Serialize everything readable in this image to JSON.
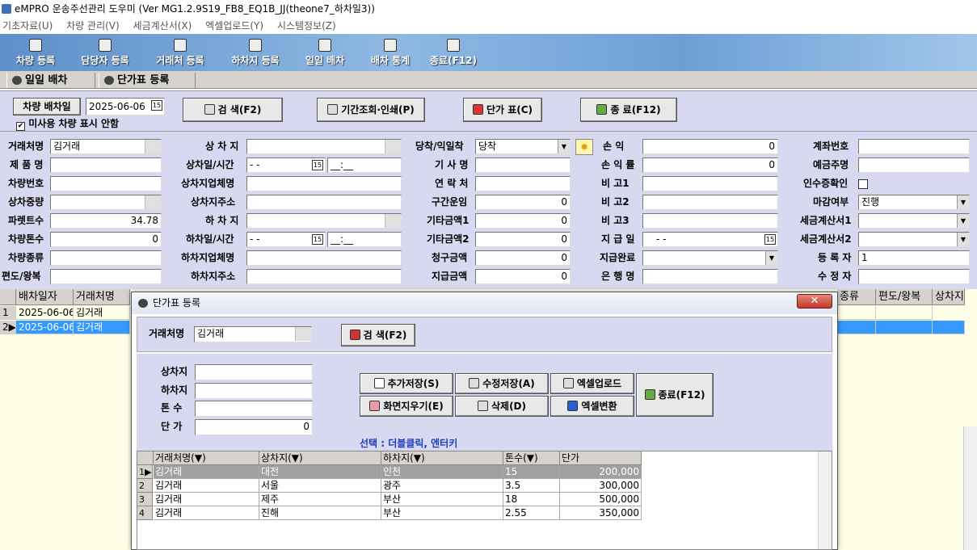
{
  "window": {
    "title": "eMPRO 운송주선관리 도우미 (Ver MG1.2.9S19_FB8_EQ1B_JJ(theone7_하차일3))"
  },
  "menu": [
    "기초자료(U)",
    "차량 관리(V)",
    "세금계산서(X)",
    "엑셀업로드(Y)",
    "시스템정보(Z)"
  ],
  "toolbar": [
    "차량 등록",
    "담당자 등록",
    "거래처 등록",
    "하차지 등록",
    "일일 배차",
    "배차 통계",
    "종료(F12)"
  ],
  "tabs": [
    "일일 배차",
    "단가표 등록"
  ],
  "top": {
    "date_label": "차량 배차일",
    "date_value": "2025-06-06",
    "search": "검 색(F2)",
    "period": "기간조회·인쇄(P)",
    "price": "단가 표(C)",
    "close": "종 료(F12)",
    "unused_label": "미사용 차량 표시 안함"
  },
  "form": {
    "client_label": "거래처명",
    "client_value": "김거래",
    "product_label": "제 품 명",
    "vehicle_no_label": "차량번호",
    "load_weight_label": "상차중량",
    "pallet_label": "파렛트수",
    "pallet_value": "34.78",
    "tonnage_label": "차량톤수",
    "tonnage_value": "0",
    "vehicle_type_label": "차량종류",
    "oneway_label": "편도/왕복",
    "load_place_label": "상 차 지",
    "load_time_label": "상차일/시간",
    "load_date_value": "- -",
    "load_time_value": "__:__",
    "load_company_label": "상차지업체명",
    "load_addr_label": "상차지주소",
    "unload_place_label": "하 차 지",
    "unload_time_label": "하차일/시간",
    "unload_date_value": "- -",
    "unload_time_value": "__:__",
    "unload_company_label": "하차지업체명",
    "unload_addr_label": "하차지주소",
    "arrival_label": "당착/익일착",
    "arrival_value": "당착",
    "driver_label": "기 사 명",
    "contact_label": "연 락 처",
    "section_fare_label": "구간운임",
    "section_fare_value": "0",
    "other1_label": "기타금액1",
    "other1_value": "0",
    "other2_label": "기타금액2",
    "other2_value": "0",
    "bill_label": "청구금액",
    "bill_value": "0",
    "pay_label": "지급금액",
    "pay_value": "0",
    "profit_label": "손 익",
    "profit_value": "0",
    "profit_rate_label": "손 익 률",
    "profit_rate_value": "0",
    "note1_label": "비 고1",
    "note2_label": "비 고2",
    "note3_label": "비 고3",
    "pay_date_label": "지 급 일",
    "pay_date_value": "- -",
    "pay_done_label": "지급완료",
    "bank_label": "은 행 명",
    "account_label": "계좌번호",
    "holder_label": "예금주명",
    "receipt_label": "인수증확인",
    "close_label": "마감여부",
    "close_value": "진행",
    "tax1_label": "세금계산서1",
    "tax2_label": "세금계산서2",
    "registrar_label": "등 록 자",
    "registrar_value": "1",
    "modifier_label": "수 정 자"
  },
  "grid": {
    "headers": [
      "배차일자",
      "거래처명",
      "종류",
      "편도/왕복",
      "상차지"
    ],
    "rows": [
      {
        "no": "1",
        "date": "2025-06-06",
        "client": "김거래"
      },
      {
        "no": "2",
        "date": "2025-06-06",
        "client": "김거래"
      }
    ]
  },
  "dialog": {
    "title": "단가표 등록",
    "close": "✕",
    "client_label": "거래처명",
    "client_value": "김거래",
    "search": "검 색(F2)",
    "load_label": "상차지",
    "unload_label": "하차지",
    "ton_label": "톤 수",
    "price_label": "단 가",
    "price_value": "0",
    "add": "추가저장(S)",
    "edit": "수정저장(A)",
    "excel_upload": "엑셀업로드",
    "clear": "화면지우기(E)",
    "delete": "삭제(D)",
    "excel_convert": "엑셀변환",
    "close_btn": "종료(F12)",
    "hint": "선택 : 더블클릭, 엔터키",
    "headers": [
      "거래처명(▼)",
      "상차지(▼)",
      "하차지(▼)",
      "톤수(▼)",
      "단가"
    ],
    "rows": [
      {
        "no": "1",
        "client": "김거래",
        "load": "대전",
        "unload": "인천",
        "ton": "15",
        "price": "200,000"
      },
      {
        "no": "2",
        "client": "김거래",
        "load": "서울",
        "unload": "광주",
        "ton": "3.5",
        "price": "300,000"
      },
      {
        "no": "3",
        "client": "김거래",
        "load": "제주",
        "unload": "부산",
        "ton": "18",
        "price": "500,000"
      },
      {
        "no": "4",
        "client": "김거래",
        "load": "진해",
        "unload": "부산",
        "ton": "2.55",
        "price": "350,000"
      }
    ]
  }
}
